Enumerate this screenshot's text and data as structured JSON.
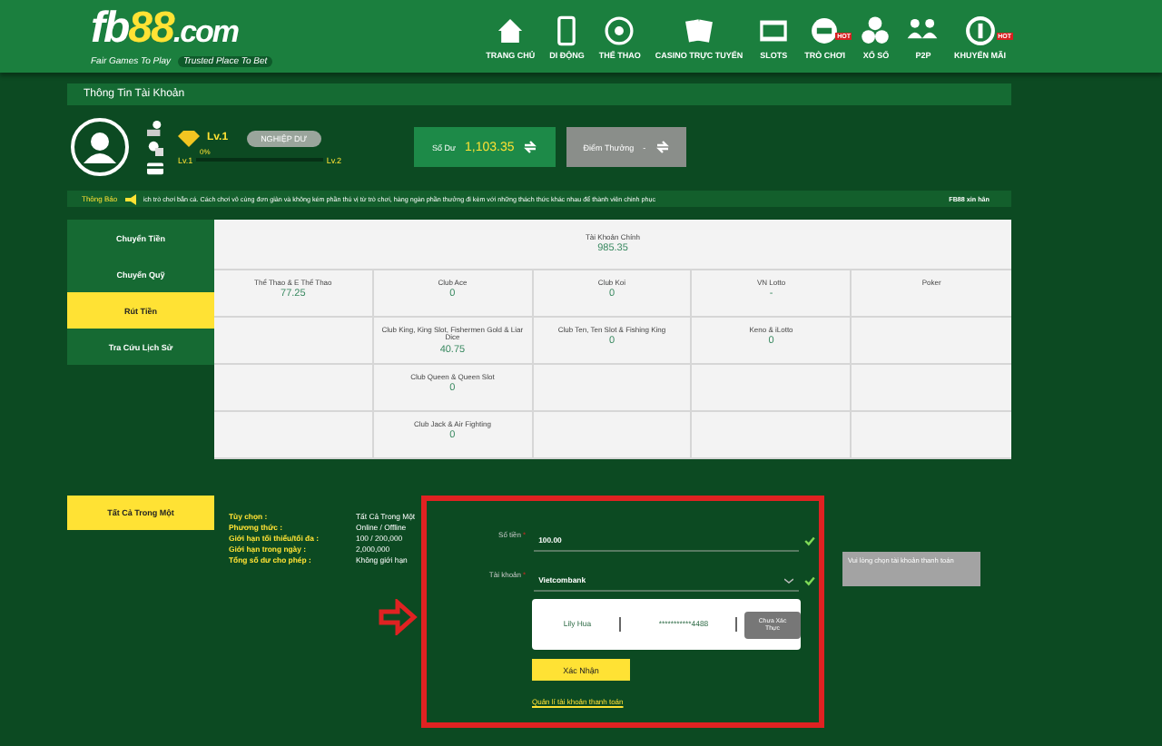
{
  "header": {
    "logo": {
      "prefix": "fb",
      "number": "88",
      "suffix": ".com"
    },
    "tagline": [
      "Fair Games To Play",
      "Trusted Place To Bet"
    ],
    "nav": [
      {
        "label": "TRANG CHỦ",
        "kind": "home"
      },
      {
        "label": "DI ĐỘNG",
        "kind": "mobile"
      },
      {
        "label": "THỂ THAO",
        "kind": "sports"
      },
      {
        "label": "CASINO TRỰC TUYẾN",
        "kind": "casino"
      },
      {
        "label": "SLOTS",
        "kind": "slots"
      },
      {
        "label": "TRÒ CHƠI",
        "kind": "games",
        "badge": "HOT"
      },
      {
        "label": "XỔ SỐ",
        "kind": "lottery"
      },
      {
        "label": "P2P",
        "kind": "p2p"
      },
      {
        "label": "KHUYẾN MÃI",
        "kind": "promo",
        "badge": "HOT"
      }
    ]
  },
  "page_title": "Thông Tin Tài Khoản",
  "profile": {
    "level": "Lv.1",
    "rank_button": "NGHIỆP DƯ",
    "progress_text": "0%",
    "from_level": "Lv.1",
    "to_level": "Lv.2",
    "progress": {
      "level": 0
    },
    "balance": {
      "label": "Số Dư",
      "value": "1,103.35"
    },
    "points": {
      "label": "Điểm Thưởng",
      "value": "-"
    }
  },
  "notice": {
    "label": "Thông Báo",
    "text": "ích trò chơi bắn cá. Cách chơi vô cùng đơn giản và không kém phần thú vị từ trò chơi, hàng ngàn phần thưởng đi kèm với những thách thức khác nhau để thành viên chinh phục",
    "tail": "FB88 xin hân"
  },
  "sidebar": {
    "items": [
      {
        "label": "Chuyển Tiền",
        "selected": false
      },
      {
        "label": "Chuyển Quỹ",
        "selected": false
      },
      {
        "label": "Rút Tiền",
        "selected": true
      },
      {
        "label": "Tra Cứu Lịch Sử",
        "selected": false
      }
    ]
  },
  "wallets": {
    "main": {
      "name": "Tài Khoản Chính",
      "value": "985.35"
    },
    "rows": [
      [
        {
          "name": "Thể Thao & E Thể Thao",
          "value": "77.25"
        },
        {
          "name": "Club Ace",
          "value": "0"
        },
        {
          "name": "Club Koi",
          "value": "0"
        },
        {
          "name": "VN Lotto",
          "value": "-"
        },
        {
          "name": "Poker"
        }
      ],
      [
        null,
        {
          "name": "Club King, King Slot, Fishermen Gold & Liar Dice",
          "value": "40.75"
        },
        {
          "name": "Club Ten, Ten Slot & Fishing King",
          "value": "0"
        },
        {
          "name": "Keno & iLotto",
          "value": "0"
        },
        null
      ],
      [
        null,
        {
          "name": "Club Queen & Queen Slot",
          "value": "0"
        },
        null,
        null,
        null
      ],
      [
        null,
        {
          "name": "Club Jack & Air Fighting",
          "value": "0"
        },
        null,
        null,
        null
      ]
    ]
  },
  "method_button": "Tất Cả Trong Một",
  "info": [
    {
      "label": "Tùy chọn :",
      "value": "Tất Cả Trong Một"
    },
    {
      "label": "Phương thức :",
      "value": "Online / Offline"
    },
    {
      "label": "Giới hạn tối thiểu/tối đa :",
      "value": "100 / 200,000"
    },
    {
      "label": "Giới hạn trong ngày :",
      "value": "2,000,000"
    },
    {
      "label": "Tổng số dư cho phép :",
      "value": "Không giới hạn"
    }
  ],
  "form": {
    "fields": [
      {
        "kind": "input",
        "label": "Số tiền",
        "marker": "*",
        "value": "100.00",
        "valid": true
      },
      {
        "kind": "select",
        "label": "Tài khoản",
        "marker": "*",
        "value": "Vietcombank",
        "valid": true
      }
    ],
    "tooltip": "Vui lòng chọn tài khoản thanh toán",
    "bank_card": {
      "name": "Lily Hua",
      "number": "***********4488",
      "status_button": "Chưa Xác Thực"
    },
    "submit": "Xác Nhận",
    "manage_link": "Quản lí tài khoản thanh toán"
  }
}
